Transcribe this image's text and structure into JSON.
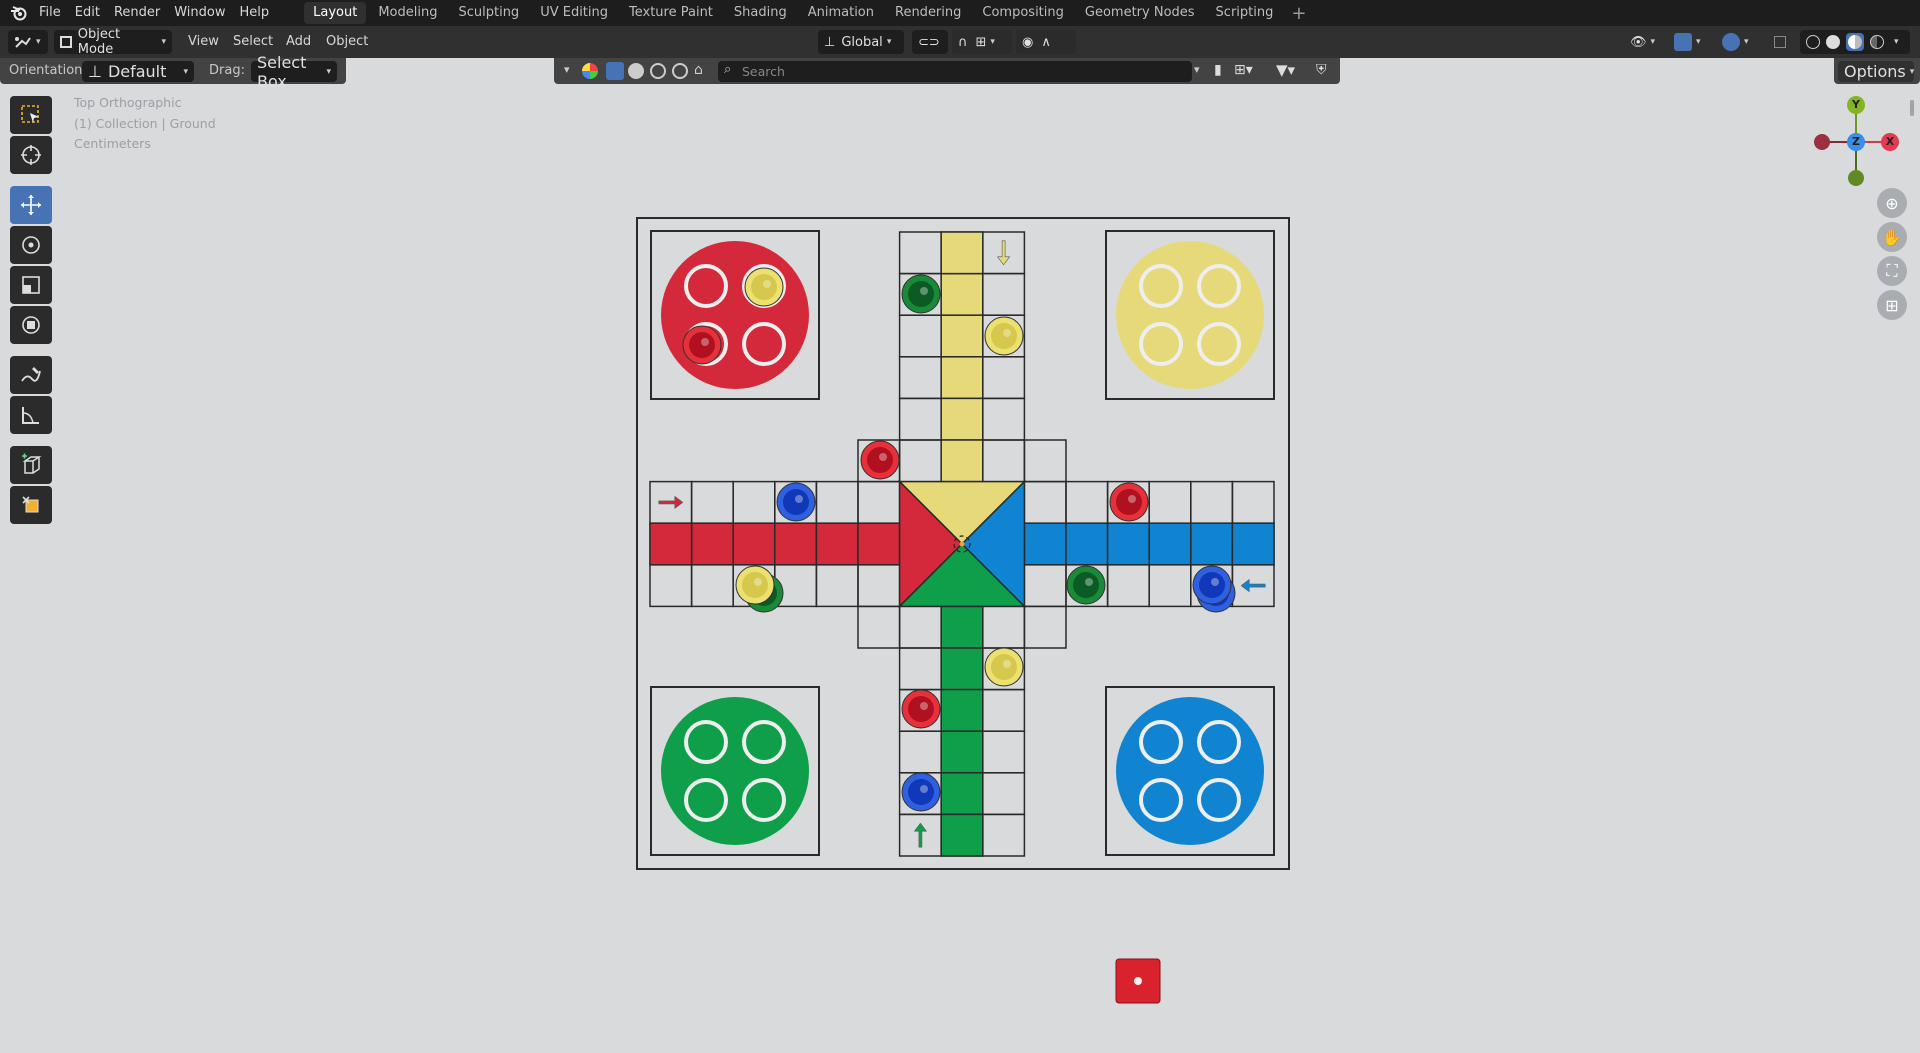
{
  "menu": {
    "file": "File",
    "edit": "Edit",
    "render": "Render",
    "window": "Window",
    "help": "Help"
  },
  "workspaces": [
    "Layout",
    "Modeling",
    "Sculpting",
    "UV Editing",
    "Texture Paint",
    "Shading",
    "Animation",
    "Rendering",
    "Compositing",
    "Geometry Nodes",
    "Scripting"
  ],
  "active_workspace": "Layout",
  "header": {
    "mode": "Object Mode",
    "view": "View",
    "select": "Select",
    "add": "Add",
    "object": "Object",
    "transform_orientation": "Global"
  },
  "toolsettings": {
    "orientation_label": "Orientation:",
    "orientation_value": "Default",
    "drag_label": "Drag:",
    "drag_value": "Select Box",
    "search_placeholder": "Search",
    "options": "Options"
  },
  "viewport": {
    "view_name": "Top Orthographic",
    "collection": "(1) Collection | Ground",
    "units": "Centimeters"
  },
  "gizmo": {
    "x": "X",
    "y": "Y",
    "z": "Z"
  },
  "colors": {
    "red": "#d4293a",
    "yellow": "#e6d97a",
    "green": "#0f9e4a",
    "blue": "#1084d0",
    "accent": "#4772b3",
    "bg": "#d8dadc"
  },
  "icons": [
    "blender-logo-icon",
    "select-box-icon",
    "cursor-icon",
    "move-icon",
    "rotate-icon",
    "scale-icon",
    "transform-icon",
    "annotate-icon",
    "measure-icon",
    "add-cube-icon",
    "zoom-icon",
    "pan-hand-icon",
    "camera-icon",
    "grid-icon"
  ]
}
